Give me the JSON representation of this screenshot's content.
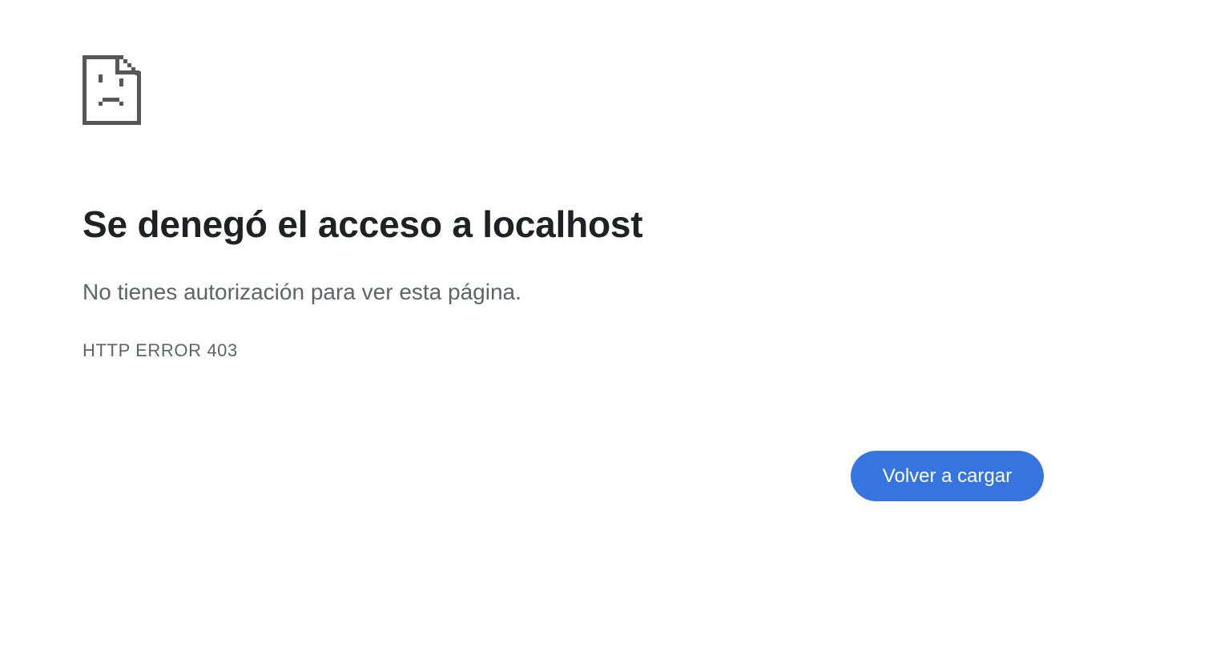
{
  "error_page": {
    "icon": "sad-document-icon",
    "heading": "Se denegó el acceso a localhost",
    "description": "No tienes autorización para ver esta página.",
    "error_code": "HTTP ERROR 403",
    "reload_label": "Volver a cargar"
  },
  "colors": {
    "background": "#ffffff",
    "heading": "#202124",
    "secondary_text": "#5f6368",
    "icon": "#575757",
    "button_background": "#3674e0",
    "button_text": "#ffffff"
  }
}
